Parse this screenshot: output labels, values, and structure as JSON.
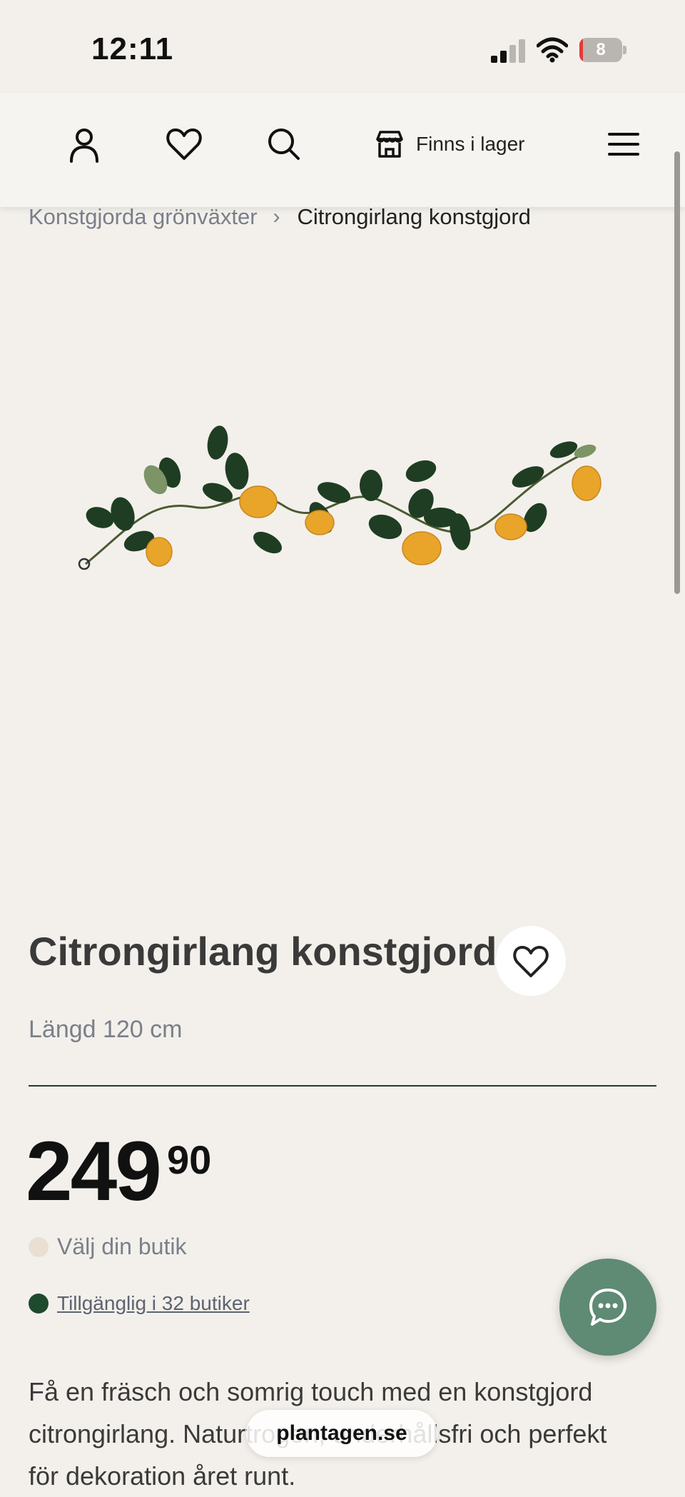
{
  "status_bar": {
    "time": "12:11",
    "battery_level": "8",
    "battery_fraction": 0.08,
    "signal_bars_filled": 2,
    "signal_bars_total": 4
  },
  "header": {
    "icons": [
      "account-icon",
      "heart-icon",
      "search-icon",
      "store-icon",
      "menu-icon"
    ],
    "store_label": "Finns i lager"
  },
  "breadcrumb": {
    "parent": "Konstgjorda grönväxter",
    "separator": "›",
    "current": "Citrongirlang konstgjord"
  },
  "product": {
    "title": "Citrongirlang konstgjord",
    "subtitle": "Längd 120 cm",
    "price_integer": "249",
    "price_decimal": "90",
    "store_choose": "Välj din butik",
    "availability": "Tillgänglig i 32 butiker",
    "description": "Få en fräsch och somrig touch med en konstgjord citrongirlang. Naturtrogen, underhållsfri och perfekt för dekoration året runt."
  },
  "browser": {
    "url": "plantagen.se"
  },
  "colors": {
    "background": "#f3f0eb",
    "accent_green": "#1e4a2e",
    "chat_button": "#5f8a73",
    "battery_low": "#e53935"
  }
}
